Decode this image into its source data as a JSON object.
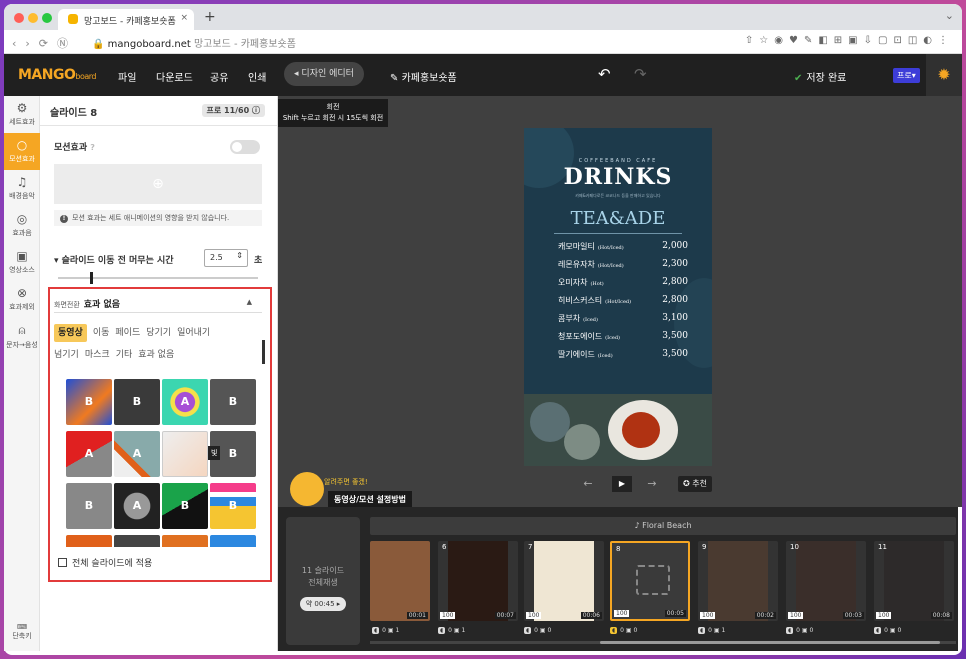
{
  "browser": {
    "tab_title": "망고보드 - 카페홍보숏폼",
    "url_domain": "mangoboard.net",
    "url_rest": "망고보드 - 카페홍보숏폼"
  },
  "appbar": {
    "logo": "MANGO",
    "logo_suffix": "board",
    "menu": [
      "파일",
      "다운로드",
      "공유",
      "인쇄"
    ],
    "design_editor": "◂ 디자인 에디터",
    "doc_name": "카페홍보숏폼",
    "saved": "저장 완료",
    "pro": "프로▾"
  },
  "rail": {
    "items": [
      {
        "label": "세트효과",
        "icon": "⚙"
      },
      {
        "label": "모션효과",
        "icon": "○"
      },
      {
        "label": "배경음악",
        "icon": "♫"
      },
      {
        "label": "효과음",
        "icon": "◎"
      },
      {
        "label": "영상소스",
        "icon": "▣"
      },
      {
        "label": "효과제외",
        "icon": "⊗"
      },
      {
        "label": "문자→음성",
        "icon": "🎤"
      }
    ],
    "shortcut": "단축키"
  },
  "panel": {
    "title": "슬라이드 8",
    "pro_badge": "프로 11/60",
    "motion_label": "모션효과",
    "motion_note": "모션 효과는 세트 애니메이션의 영향을 받지 않습니다.",
    "dwell_label": "슬라이드 이동 전 머무는 시간",
    "dwell_value": "2.5",
    "dwell_unit": "초",
    "transition_label": "화면전환",
    "transition_value": "효과 없음",
    "categories": [
      "동영상",
      "이동",
      "페이드",
      "당기기",
      "일어내기",
      "넘기기",
      "마스크",
      "기타",
      "효과 없음"
    ],
    "thumb_tooltip": "빛",
    "apply_all": "전체 슬라이드에 적용"
  },
  "stage": {
    "tooltip_title": "회전",
    "tooltip_desc": "Shift 누르고 회전 시 15도씩 회전",
    "recommend": "추천",
    "mascot_bubble": "알려주면 좋겠!",
    "howto": "동영상/모션 설정방법"
  },
  "poster": {
    "cafe": "COFFEEBAND CAFE",
    "title": "DRINKS",
    "subtitle": "카페&카페다로든 코코나드 등을 판매하고 있습니다",
    "section": "TEA&ADE",
    "items": [
      {
        "name": "캐모마일티",
        "note": "(Hot/Iced)",
        "price": "2,000"
      },
      {
        "name": "레몬유자차",
        "note": "(Hot/Iced)",
        "price": "2,300"
      },
      {
        "name": "오미자차",
        "note": "(Hot)",
        "price": "2,800"
      },
      {
        "name": "히비스커스티",
        "note": "(Hot/Iced)",
        "price": "2,800"
      },
      {
        "name": "콤부차",
        "note": "(Iced)",
        "price": "3,100"
      },
      {
        "name": "청포도에이드",
        "note": "(Iced)",
        "price": "3,500"
      },
      {
        "name": "딸기에이드",
        "note": "(Iced)",
        "price": "3,500"
      }
    ]
  },
  "timeline": {
    "summary_line1": "11 슬라이드",
    "summary_line2": "전체재생",
    "summary_time": "약 00:45 ▸",
    "music": "♪ Floral Beach",
    "slides": [
      {
        "num": "",
        "dur": "00:01",
        "vol": "",
        "color": "#8a5a3a",
        "s1": "0",
        "s2": "1"
      },
      {
        "num": "6",
        "dur": "00:07",
        "vol": "100",
        "color": "#2a1a14",
        "s1": "0",
        "s2": "1"
      },
      {
        "num": "7",
        "dur": "00:06",
        "vol": "100",
        "color": "#efe6d3",
        "s1": "0",
        "s2": "0"
      },
      {
        "num": "8",
        "dur": "00:05",
        "vol": "100",
        "color": "",
        "s1": "0",
        "s2": "0"
      },
      {
        "num": "9",
        "dur": "00:02",
        "vol": "100",
        "color": "#4a3a30",
        "s1": "0",
        "s2": "1"
      },
      {
        "num": "10",
        "dur": "00:03",
        "vol": "100",
        "color": "#3a2e2a",
        "s1": "0",
        "s2": "0"
      },
      {
        "num": "11",
        "dur": "00:08",
        "vol": "100",
        "color": "#2d2a2a",
        "s1": "0",
        "s2": "0"
      }
    ]
  }
}
